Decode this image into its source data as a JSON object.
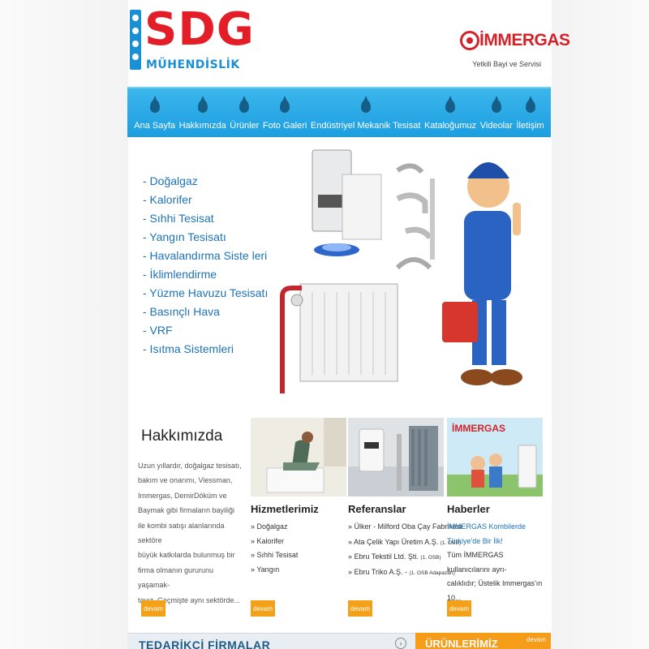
{
  "header": {
    "logo_text": "SDG",
    "logo_subtitle": "MÜHENDİSLİK",
    "brand_name": "İMMERGAS",
    "brand_tagline": "Yetkili Bayi ve Servisi"
  },
  "nav": {
    "items": [
      "Ana Sayfa",
      "Hakkımızda",
      "Ürünler",
      "Foto Galeri",
      "Endüstriyel Mekanik Tesisat",
      "Kataloğumuz",
      "Videolar",
      "İletişim"
    ]
  },
  "services": [
    "- Doğalgaz",
    "- Kalorifer",
    "- Sıhhi Tesisat",
    "- Yangın Tesisatı",
    "- Havalandırma Siste   leri",
    "- İklimlendirme",
    "- Yüzme Havuzu Tesisatı",
    "- Basınçlı Hava",
    "- VRF",
    "- Isıtma Sistemleri"
  ],
  "about": {
    "title": "Hakkımızda",
    "lines": [
      "Uzun yıllardır, doğalgaz tesisatı,",
      "bakım ve onarımı, Viessman,",
      "Immergas, DemirDöküm ve",
      "Baymak gibi firmaların bayiliği",
      "ile kombi satışı alanlarında sektöre",
      "büyük katkılarda bulunmuş bir",
      "firma olmanın gururunu yaşamak-",
      "tayız. Geçmişte aynı sektörde..."
    ]
  },
  "hizmet": {
    "title": "Hizmetlerimiz",
    "items": [
      "» Doğalgaz",
      "» Kalorifer",
      "» Sıhhi Tesisat",
      "» Yangın"
    ]
  },
  "referans": {
    "title": "Referanslar",
    "items": [
      {
        "text": "» Ülker - Milford Oba Çay Fabrikası",
        "note": ""
      },
      {
        "text": "» Ata Çelik Yapı Üretim A.Ş. ",
        "note": "(1. OSB)"
      },
      {
        "text": "» Ebru Tekstil Ltd. Şti. ",
        "note": "(1. OSB)"
      },
      {
        "text": "» Ebru Triko A.Ş. - ",
        "note": "(1. OSB Adapazarı)"
      }
    ]
  },
  "haber": {
    "title": "Haberler",
    "image_brand": "İMMERGAS",
    "headline1": "İMMERGAS Kombilerde",
    "headline2": "Türkiye'de Bir İlk!",
    "body1": "Tüm İMMERGAS kullanıcılarını ayrı-",
    "body2": "calıklıdır; Üstelik Immergas'ın 10..."
  },
  "devam_label": "devam",
  "bottom": {
    "left_title": "TEDARİKÇİ FİRMALAR",
    "arrow": "›",
    "right_title": "ÜRÜNLERİMİZ",
    "right_link": "devam"
  },
  "colors": {
    "nav_blue": "#1c9ee0",
    "logo_red": "#e41e26",
    "link_blue": "#1e73b8",
    "accent_orange": "#f4a11a"
  }
}
